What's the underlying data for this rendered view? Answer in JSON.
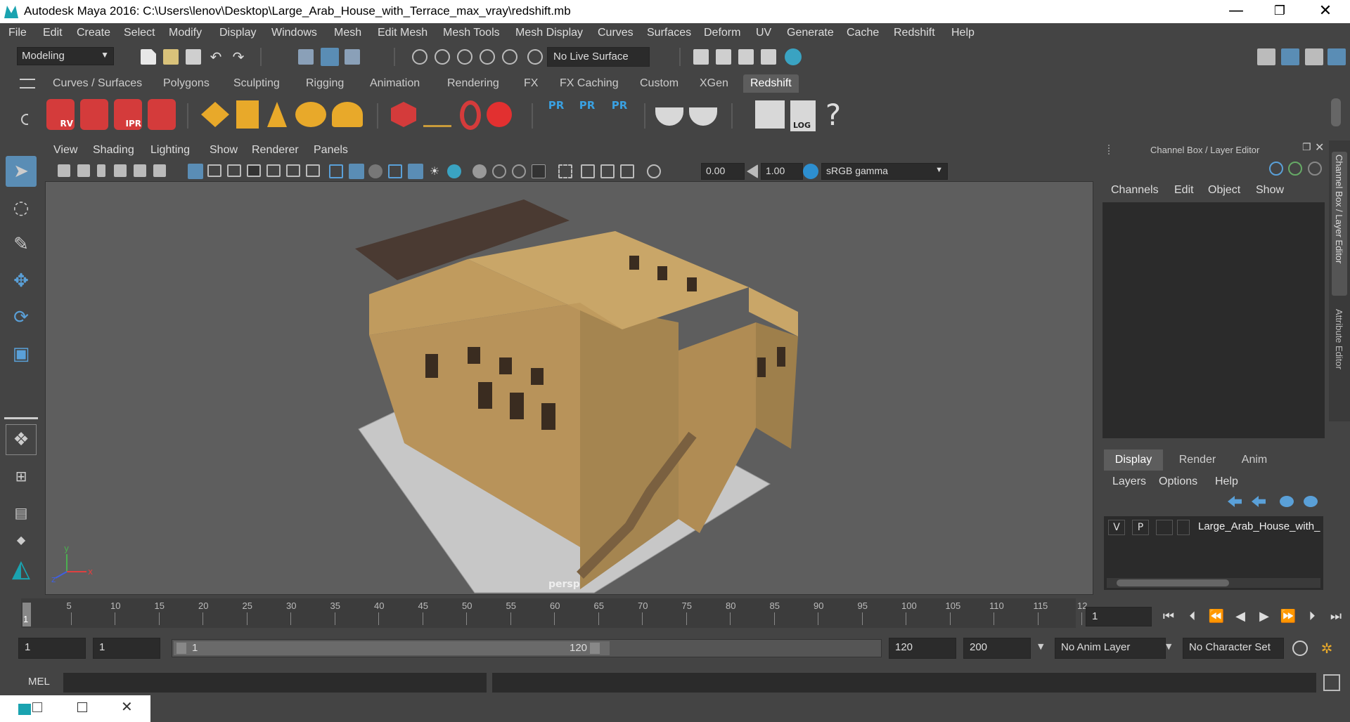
{
  "window": {
    "title": "Autodesk Maya 2016: C:\\Users\\lenov\\Desktop\\Large_Arab_House_with_Terrace_max_vray\\redshift.mb",
    "minimize": "—",
    "maximize": "❐",
    "close": "✕"
  },
  "menu": [
    "File",
    "Edit",
    "Create",
    "Select",
    "Modify",
    "Display",
    "Windows",
    "Mesh",
    "Edit Mesh",
    "Mesh Tools",
    "Mesh Display",
    "Curves",
    "Surfaces",
    "Deform",
    "UV",
    "Generate",
    "Cache",
    "Redshift",
    "Help"
  ],
  "status": {
    "mode": "Modeling",
    "live_surface": "No Live Surface"
  },
  "shelf_tabs": [
    "Curves / Surfaces",
    "Polygons",
    "Sculpting",
    "Rigging",
    "Animation",
    "Rendering",
    "FX",
    "FX Caching",
    "Custom",
    "XGen",
    "Redshift"
  ],
  "shelf_active": "Redshift",
  "shelf_labels": {
    "rv": "RV",
    "ipr": "IPR",
    "pr": "PR",
    "log": "LOG",
    "help": "?"
  },
  "viewport": {
    "menu": [
      "View",
      "Shading",
      "Lighting",
      "Show",
      "Renderer",
      "Panels"
    ],
    "exposure": "0.00",
    "gamma": "1.00",
    "colorspace": "sRGB gamma",
    "camera": "persp",
    "axis": {
      "x": "x",
      "y": "y",
      "z": "z"
    }
  },
  "channel_box": {
    "title": "Channel Box / Layer Editor",
    "menu": [
      "Channels",
      "Edit",
      "Object",
      "Show"
    ],
    "side_tabs": [
      "Channel Box / Layer Editor",
      "Attribute Editor"
    ]
  },
  "layers": {
    "tabs": [
      "Display",
      "Render",
      "Anim"
    ],
    "menu": [
      "Layers",
      "Options",
      "Help"
    ],
    "row": {
      "v": "V",
      "p": "P",
      "name": "Large_Arab_House_with_"
    }
  },
  "timeline": {
    "ticks": [
      "5",
      "10",
      "15",
      "20",
      "25",
      "30",
      "35",
      "40",
      "45",
      "50",
      "55",
      "60",
      "65",
      "70",
      "75",
      "80",
      "85",
      "90",
      "95",
      "100",
      "105",
      "110",
      "115",
      "12"
    ],
    "current_marker": "1",
    "current_frame": "1"
  },
  "range": {
    "start": "1",
    "playback_start": "1",
    "slider_start": "1",
    "slider_end": "120",
    "playback_end": "120",
    "end": "200",
    "anim_layer": "No Anim Layer",
    "character_set": "No Character Set"
  },
  "mel": {
    "label": "MEL"
  }
}
